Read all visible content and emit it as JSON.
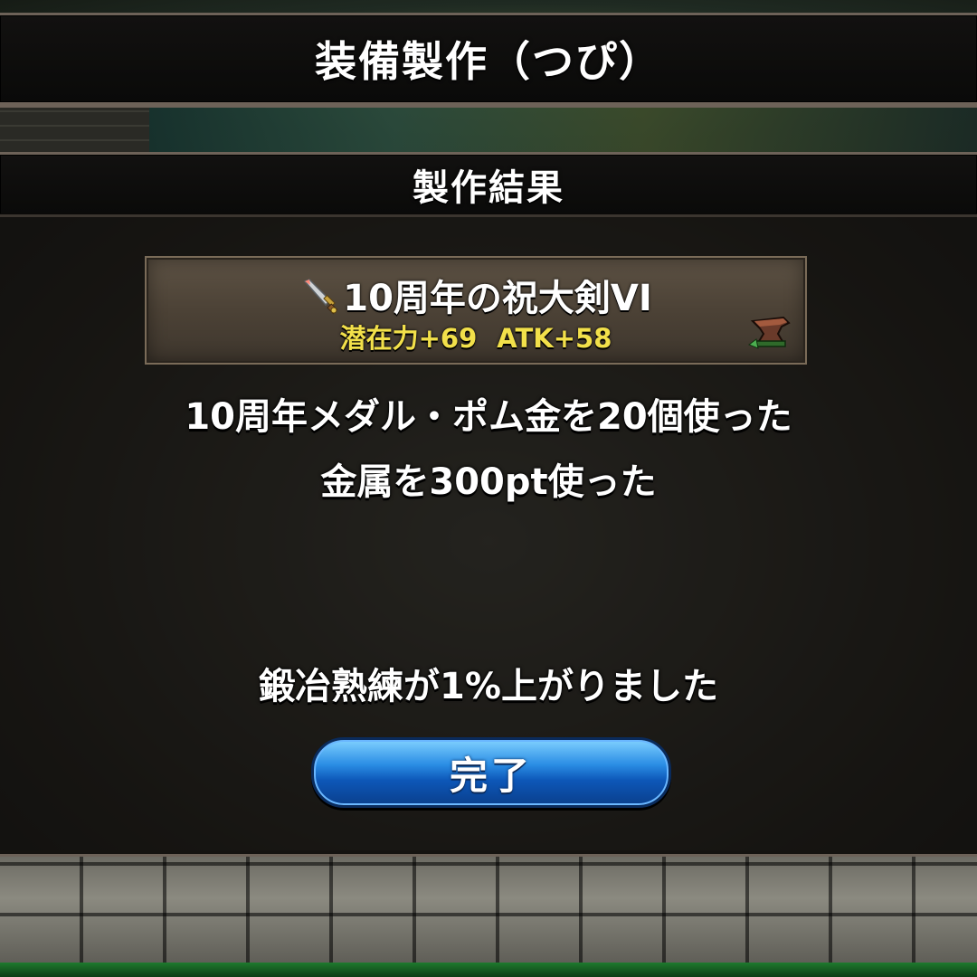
{
  "header": {
    "title": "装備製作（つぴ）"
  },
  "subheader": {
    "title": "製作結果"
  },
  "result_item": {
    "name": "10周年の祝大剣VI",
    "icon": "sword-icon",
    "stat_potential": "潜在力+69",
    "stat_atk": "ATK+58",
    "badge_icon": "anvil-icon"
  },
  "messages": {
    "materials_used": "10周年メダル・ポム金を20個使った",
    "metal_used": "金属を300pt使った",
    "skill_up": "鍛冶熟練が1%上がりました"
  },
  "buttons": {
    "done_label": "完了"
  },
  "colors": {
    "stat_text": "#f2e04a",
    "button_blue": "#2a8de4",
    "bar_border": "#6d6258",
    "bottom_bar": "#1f7a2e"
  }
}
